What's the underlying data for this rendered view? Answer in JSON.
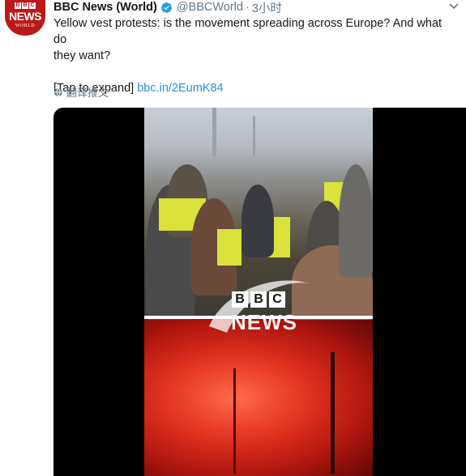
{
  "account": {
    "display_name": "BBC News (World)",
    "handle": "@BBCWorld",
    "separator": "·",
    "timestamp": "3小时",
    "avatar": {
      "bbc_letters": [
        "B",
        "B",
        "C"
      ],
      "news": "NEWS",
      "world": "WORLD"
    }
  },
  "tweet": {
    "text_line1": "Yellow vest protests: is the movement spreading across Europe? And what do",
    "text_line2": "they want?",
    "expand_prefix": "[Tap to expand]",
    "link": "bbc.in/2EumK84",
    "translate_label": "翻译推文"
  },
  "media": {
    "logo_letters": [
      "B",
      "B",
      "C"
    ],
    "logo_word": "NEWS"
  },
  "colors": {
    "link": "#1b95e0",
    "verified": "#1da1f2",
    "secondary_text": "#657786",
    "avatar_red": "#bb1919"
  },
  "icons": {
    "verified": "verified-badge-icon",
    "caret": "chevron-down-icon",
    "translate": "globe-icon"
  }
}
